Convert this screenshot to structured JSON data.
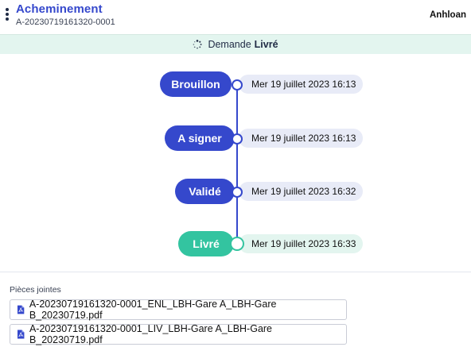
{
  "header": {
    "title": "Acheminement",
    "reference": "A-20230719161320-0001",
    "user": "Anhloan"
  },
  "status": {
    "prefix": "Demande",
    "value": "Livré"
  },
  "timeline": {
    "steps": [
      {
        "label": "Brouillon",
        "date": "Mer 19 juillet 2023 16:13",
        "color": "#3548cc"
      },
      {
        "label": "A signer",
        "date": "Mer 19 juillet 2023 16:13",
        "color": "#3548cc"
      },
      {
        "label": "Validé",
        "date": "Mer 19 juillet 2023 16:32",
        "color": "#3548cc"
      },
      {
        "label": "Livré",
        "date": "Mer 19 juillet 2023 16:33",
        "color": "#33c4a0",
        "current": true
      }
    ]
  },
  "attachments": {
    "heading": "Pièces jointes",
    "files": [
      "A-20230719161320-0001_ENL_LBH-Gare A_LBH-Gare B_20230719.pdf",
      "A-20230719161320-0001_LIV_LBH-Gare A_LBH-Gare B_20230719.pdf"
    ]
  },
  "colors": {
    "primary": "#3548cc",
    "success": "#33c4a0",
    "status_background": "#e3f5ef",
    "date_pill_background": "#e8ebf7"
  },
  "icons": [
    "more-vertical-icon",
    "loading-spinner-icon",
    "pdf-file-icon"
  ]
}
